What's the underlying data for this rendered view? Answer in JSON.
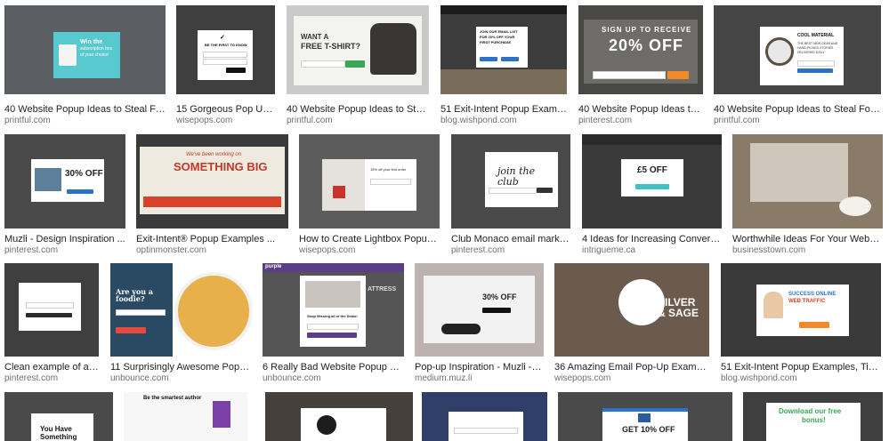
{
  "results": [
    {
      "caption": "40 Website Popup Ideas to Steal For ...",
      "source": "printful.com",
      "popup_lines": [
        "Win the",
        "subscription box",
        "of your choice!"
      ]
    },
    {
      "caption": "15 Gorgeous Pop Up Design Ex...",
      "source": "wisepops.com",
      "popup_lines": [
        "BE THE FIRST TO KNOW"
      ]
    },
    {
      "caption": "40 Website Popup Ideas to Steal For ...",
      "source": "printful.com",
      "popup_lines": [
        "WANT A",
        "FREE T-SHIRT?"
      ]
    },
    {
      "caption": "51 Exit-Intent Popup Examples, Tips ...",
      "source": "blog.wishpond.com",
      "popup_lines": [
        "JOIN OUR EMAIL LIST",
        "FOR 20% OFF YOUR",
        "FIRST PURCHASE"
      ]
    },
    {
      "caption": "40 Website Popup Ideas to Steal For ...",
      "source": "pinterest.com",
      "popup_lines": [
        "SIGN UP TO RECEIVE",
        "20% OFF"
      ]
    },
    {
      "caption": "40 Website Popup Ideas to Steal For ...",
      "source": "printful.com",
      "popup_lines": [
        "COOL MATERIAL",
        "THE BEST NEW GEAR AND",
        "HAND-PICKED STORIES",
        "DELIVERED DAILY"
      ]
    },
    {
      "caption": "Muzli - Design Inspiration ...",
      "source": "pinterest.com",
      "popup_lines": [
        "30% OFF"
      ]
    },
    {
      "caption": "Exit-Intent® Popup Examples ...",
      "source": "optinmonster.com",
      "popup_lines": [
        "We've been working on",
        "SOMETHING BIG"
      ]
    },
    {
      "caption": "How to Create Lightbox Popups That Work ...",
      "source": "wisepops.com",
      "popup_lines": [
        "15% off your first order"
      ]
    },
    {
      "caption": "Club Monaco email marketing modal ...",
      "source": "pinterest.com",
      "popup_lines": [
        "join the club"
      ]
    },
    {
      "caption": "4 Ideas for Increasing Conversions on ...",
      "source": "intrigueme.ca",
      "popup_lines": [
        "£5 OFF"
      ]
    },
    {
      "caption": "Worthwhile Ideas For Your Website Popup ...",
      "source": "businesstown.com",
      "popup_lines": []
    },
    {
      "caption": "Clean example of an email si...",
      "source": "pinterest.com",
      "popup_lines": []
    },
    {
      "caption": "11 Surprisingly Awesome Popup Design ...",
      "source": "unbounce.com",
      "popup_lines": [
        "Are you a foodie?"
      ]
    },
    {
      "caption": "6 Really Bad Website Popup Examples",
      "source": "unbounce.com",
      "popup_lines": [
        "purple",
        "ATTRESS",
        "Shop Missing all of the Deals!"
      ]
    },
    {
      "caption": "Pop-up Inspiration - Muzli - Design ...",
      "source": "medium.muz.li",
      "popup_lines": [
        "30% OFF"
      ]
    },
    {
      "caption": "36 Amazing Email Pop-Up Examples and ...",
      "source": "wisepops.com",
      "popup_lines": [
        "SILVER",
        "& SAGE"
      ]
    },
    {
      "caption": "51 Exit-Intent Popup Examples, Tips ...",
      "source": "blog.wishpond.com",
      "popup_lines": [
        "SUCCESS ONLINE",
        "WEB TRAFFIC"
      ]
    },
    {
      "caption": "",
      "source": "",
      "popup_lines": [
        "You Have",
        "Something"
      ]
    },
    {
      "caption": "",
      "source": "",
      "popup_lines": [
        "Be the smartest author"
      ]
    },
    {
      "caption": "",
      "source": "",
      "popup_lines": []
    },
    {
      "caption": "",
      "source": "",
      "popup_lines": []
    },
    {
      "caption": "",
      "source": "",
      "popup_lines": [
        "GET 10% OFF"
      ]
    },
    {
      "caption": "",
      "source": "",
      "popup_lines": [
        "Download our free",
        "bonus!"
      ]
    }
  ],
  "colors": {
    "caption_text": "#222222",
    "source_text": "#707070",
    "overlay": "#3b3b3b",
    "teal": "#3fc1c9",
    "green": "#3aa757",
    "red": "#d8412a",
    "blue": "#2a73c7",
    "orange": "#f28a2a"
  }
}
